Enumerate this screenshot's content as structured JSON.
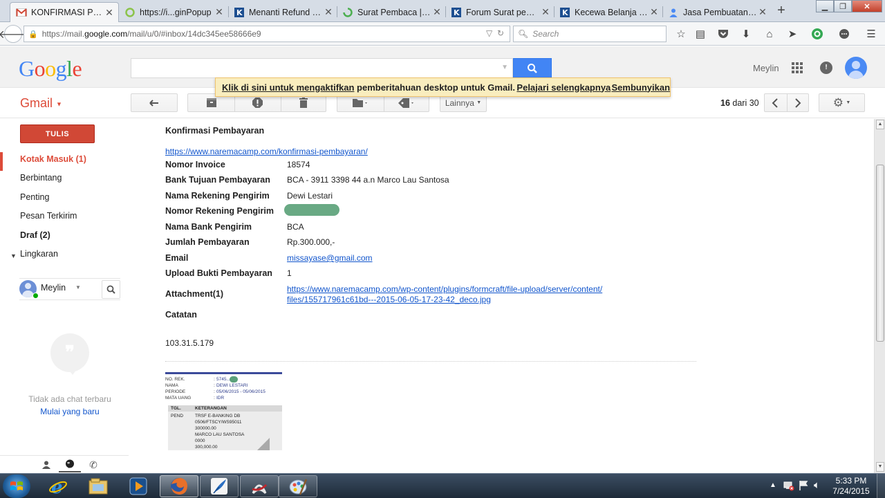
{
  "browser": {
    "tabs": [
      {
        "label": "KONFIRMASI PEM...",
        "icon": "gmail-favicon-icon"
      },
      {
        "label": "https://i...ginPopup",
        "icon": "popup-favicon-icon"
      },
      {
        "label": "Menanti Refund Y...",
        "icon": "kaskus-favicon-icon"
      },
      {
        "label": "Surat Pembaca | K...",
        "icon": "loading-spinner-icon"
      },
      {
        "label": "Forum Surat pemb...",
        "icon": "kaskus-favicon-icon"
      },
      {
        "label": "Kecewa Belanja di ...",
        "icon": "kaskus-favicon-icon"
      },
      {
        "label": "Jasa Pembuatan W...",
        "icon": "user-favicon-icon"
      }
    ],
    "url_prefix": "https://mail.",
    "url_domain": "google.com",
    "url_suffix": "/mail/u/0/#inbox/14dc345ee58666e9",
    "search_placeholder": "Search"
  },
  "google": {
    "logo": {
      "G": "G",
      "o1": "o",
      "o2": "o",
      "g": "g",
      "l": "l",
      "e": "e"
    },
    "user_name": "Meylin",
    "notification": {
      "enable_link": "Klik di sini untuk mengaktifkan",
      "text": " pemberitahuan desktop untuk Gmail.",
      "learn_more": "Pelajari selengkapnya",
      "hide": "Sembunyikan"
    }
  },
  "gmail": {
    "label": "Gmail",
    "toolbar": {
      "more_label": "Lainnya",
      "counter_bold": "16",
      "counter_rest": "dari 30"
    },
    "sidebar": {
      "compose": "TULIS",
      "items": [
        {
          "label": "Kotak Masuk (1)"
        },
        {
          "label": "Berbintang"
        },
        {
          "label": "Penting"
        },
        {
          "label": "Pesan Terkirim"
        },
        {
          "label": "Draf (2)"
        },
        {
          "label": "Lingkaran"
        }
      ],
      "chat_user": "Meylin",
      "no_chat": "Tidak ada chat terbaru",
      "start_new": "Mulai yang baru"
    }
  },
  "email": {
    "title": "Konfirmasi Pembayaran",
    "link": "https://www.naremacamp.com/konfirmasi-pembayaran/",
    "fields": [
      {
        "label": "Nomor Invoice",
        "value": "18574"
      },
      {
        "label": "Bank Tujuan Pembayaran",
        "value": "BCA - 3911 3398 44 a.n Marco Lau Santosa"
      },
      {
        "label": "Nama Rekening Pengirim",
        "value": "Dewi Lestari"
      },
      {
        "label": "Nomor Rekening Pengirim",
        "value": ""
      },
      {
        "label": "Nama Bank Pengirim",
        "value": "BCA"
      },
      {
        "label": "Jumlah Pembayaran",
        "value": "Rp.300.000,-"
      },
      {
        "label": "Email",
        "value": "missayase@gmail.com"
      },
      {
        "label": "Upload Bukti Pembayaran",
        "value": "1"
      },
      {
        "label": "Attachment(1)",
        "value_line1": "https://www.naremacamp.com/wp-content/plugins/formcraft/file-upload/server/content/",
        "value_line2": "files/155717961c61bd---2015-06-05-17-23-42_deco.jpg"
      },
      {
        "label": "Catatan",
        "value": ""
      }
    ],
    "ip": "103.31.5.179",
    "attachment_preview": {
      "rows": [
        {
          "k": "NO. REK.",
          "v": "5745...48"
        },
        {
          "k": "NAMA",
          "v": "DEWI LESTARI"
        },
        {
          "k": "PERIODE",
          "v": "05/06/2015 - 05/06/2015"
        },
        {
          "k": "MATA UANG",
          "v": "IDR"
        }
      ],
      "col_date": "TGL.",
      "col_desc": "KETERANGAN",
      "entry_date": "PEND",
      "entry_lines": [
        "TRSF E-BANKING DB",
        "0506/FTSCY/WS95011",
        "300000.00",
        "MARCO LAU SANTOSA",
        "0000",
        "300,000.00"
      ]
    }
  },
  "taskbar": {
    "clock_time": "5:33 PM",
    "clock_date": "7/24/2015"
  },
  "colors": {
    "gmail_red": "#dd4b39",
    "compose_red": "#d14836",
    "google_blue": "#4285f4",
    "link_blue": "#1155cc",
    "notif_bg": "#f9edbe"
  }
}
